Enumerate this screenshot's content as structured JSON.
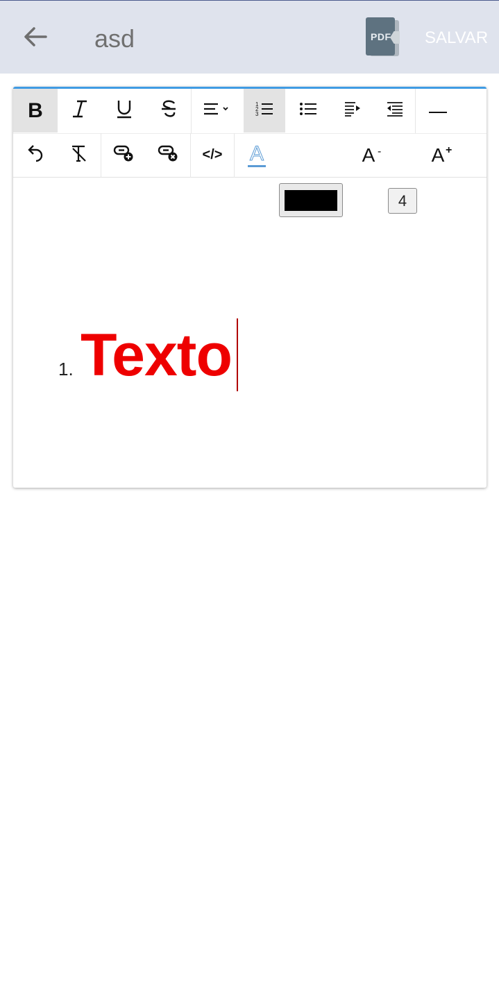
{
  "appbar": {
    "title": "asd",
    "pdf_label": "PDF",
    "save_label": "SALVAR"
  },
  "toolbar": {
    "row1": [
      "bold",
      "italic",
      "underline",
      "strikethrough",
      "align",
      "ordered-list",
      "unordered-list",
      "indent",
      "outdent",
      "horizontal-rule"
    ],
    "row2": [
      "undo",
      "clear-formatting",
      "insert-link",
      "remove-link",
      "code-view",
      "text-color",
      "font-color-swatch",
      "decrease-font-size",
      "font-size",
      "increase-font-size"
    ],
    "font_size": "4",
    "font_color": "#000000",
    "active": [
      "bold",
      "ordered-list"
    ]
  },
  "editor": {
    "list_number": "1.",
    "list_text": "Texto",
    "text_color": "#ee0000"
  },
  "labels": {
    "bold": "B",
    "italic": "I",
    "underline": "U",
    "strike": "S",
    "code": "</>",
    "text_color_letter": "A",
    "decrease": "A",
    "increase": "A"
  }
}
